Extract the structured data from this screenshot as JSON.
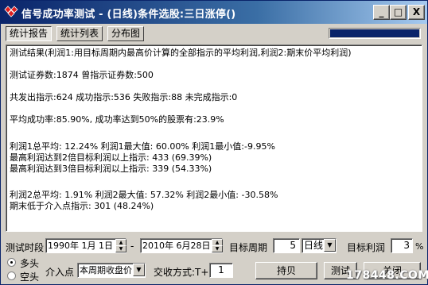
{
  "window": {
    "title": "信号成功率测试 - (日线)条件选股:三日涨停()",
    "buttons": {
      "minimize": "_",
      "maximize": "□",
      "close": "X"
    }
  },
  "tabs": [
    {
      "label": "统计报告",
      "active": true
    },
    {
      "label": "统计列表",
      "active": false
    },
    {
      "label": "分布图",
      "active": false
    }
  ],
  "progress": {
    "fraction": 1.0
  },
  "report": {
    "lines": [
      "测试结果(利润1:用目标周期内最高价计算的全部指示的平均利润,利润2:期末价平均利润)",
      "",
      "测试证券数:1874          曾指示证券数:500",
      "",
      "共发出指示:624   成功指示:536   失败指示:88   未完成指示:0",
      "",
      "平均成功率:85.90%, 成功率达到50%的股票有:23.9%",
      "",
      "利润1总平均: 12.24%   利润1最大值: 60.00%   利润1最小值:-9.95%",
      "最高利润达到2倍目标利润以上指示: 433 (69.39%)",
      "最高利润达到3倍目标利润以上指示: 339 (54.33%)",
      "",
      "利润2总平均: 1.91%   利润2最大值: 57.32%   利润2最小值: -30.58%",
      "期末低于介入点指示: 301 (48.24%)"
    ]
  },
  "controls": {
    "period_label": "测试时段",
    "start_date": "1990年 1月 1日",
    "dash": "-",
    "end_date": "2010年 6月28日",
    "target_period_label": "目标周期",
    "target_period_value": "5",
    "period_unit": "日线",
    "target_profit_label": "目标利润",
    "target_profit_value": "3",
    "percent": "%",
    "long_label": "多头",
    "short_label": "空头",
    "entry_label": "介入点",
    "entry_value": "本周期收盘价",
    "trade_mode_label": "交收方式:T+",
    "trade_mode_value": "1",
    "hold_button": "持贝",
    "test_button": "测试",
    "close_button": "关闭"
  },
  "watermark": "178448.COM"
}
